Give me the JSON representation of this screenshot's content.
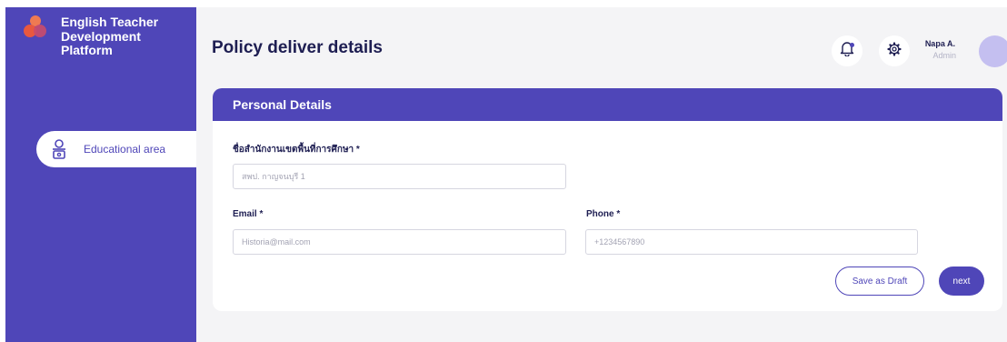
{
  "sidebar": {
    "logo_icon": "overlapping-circles-logo-icon",
    "brand": "English Teacher Development Platform",
    "items": [
      {
        "label": "Educational area",
        "icon": "person-building-icon"
      }
    ]
  },
  "header": {
    "title": "Policy deliver details",
    "notification_icon": "bell-icon",
    "settings_icon": "gear-icon",
    "user": {
      "name": "Napa A.",
      "role": "Admin"
    }
  },
  "form": {
    "section_title": "Personal Details",
    "office_label": "ชื่อสำนักงานเขตพื้นที่การศึกษา *",
    "office_placeholder": "สพป. กาญจนบุรี 1",
    "email_label": "Email *",
    "email_placeholder": "Historia@mail.com",
    "phone_label": "Phone *",
    "phone_placeholder": "+1234567890",
    "save_draft": "Save as Draft",
    "next": "next"
  },
  "colors": {
    "primary": "#4f46b8",
    "text_dark": "#1e1e52",
    "background": "#f4f4f6",
    "logo_orange": "#ef7a52"
  }
}
